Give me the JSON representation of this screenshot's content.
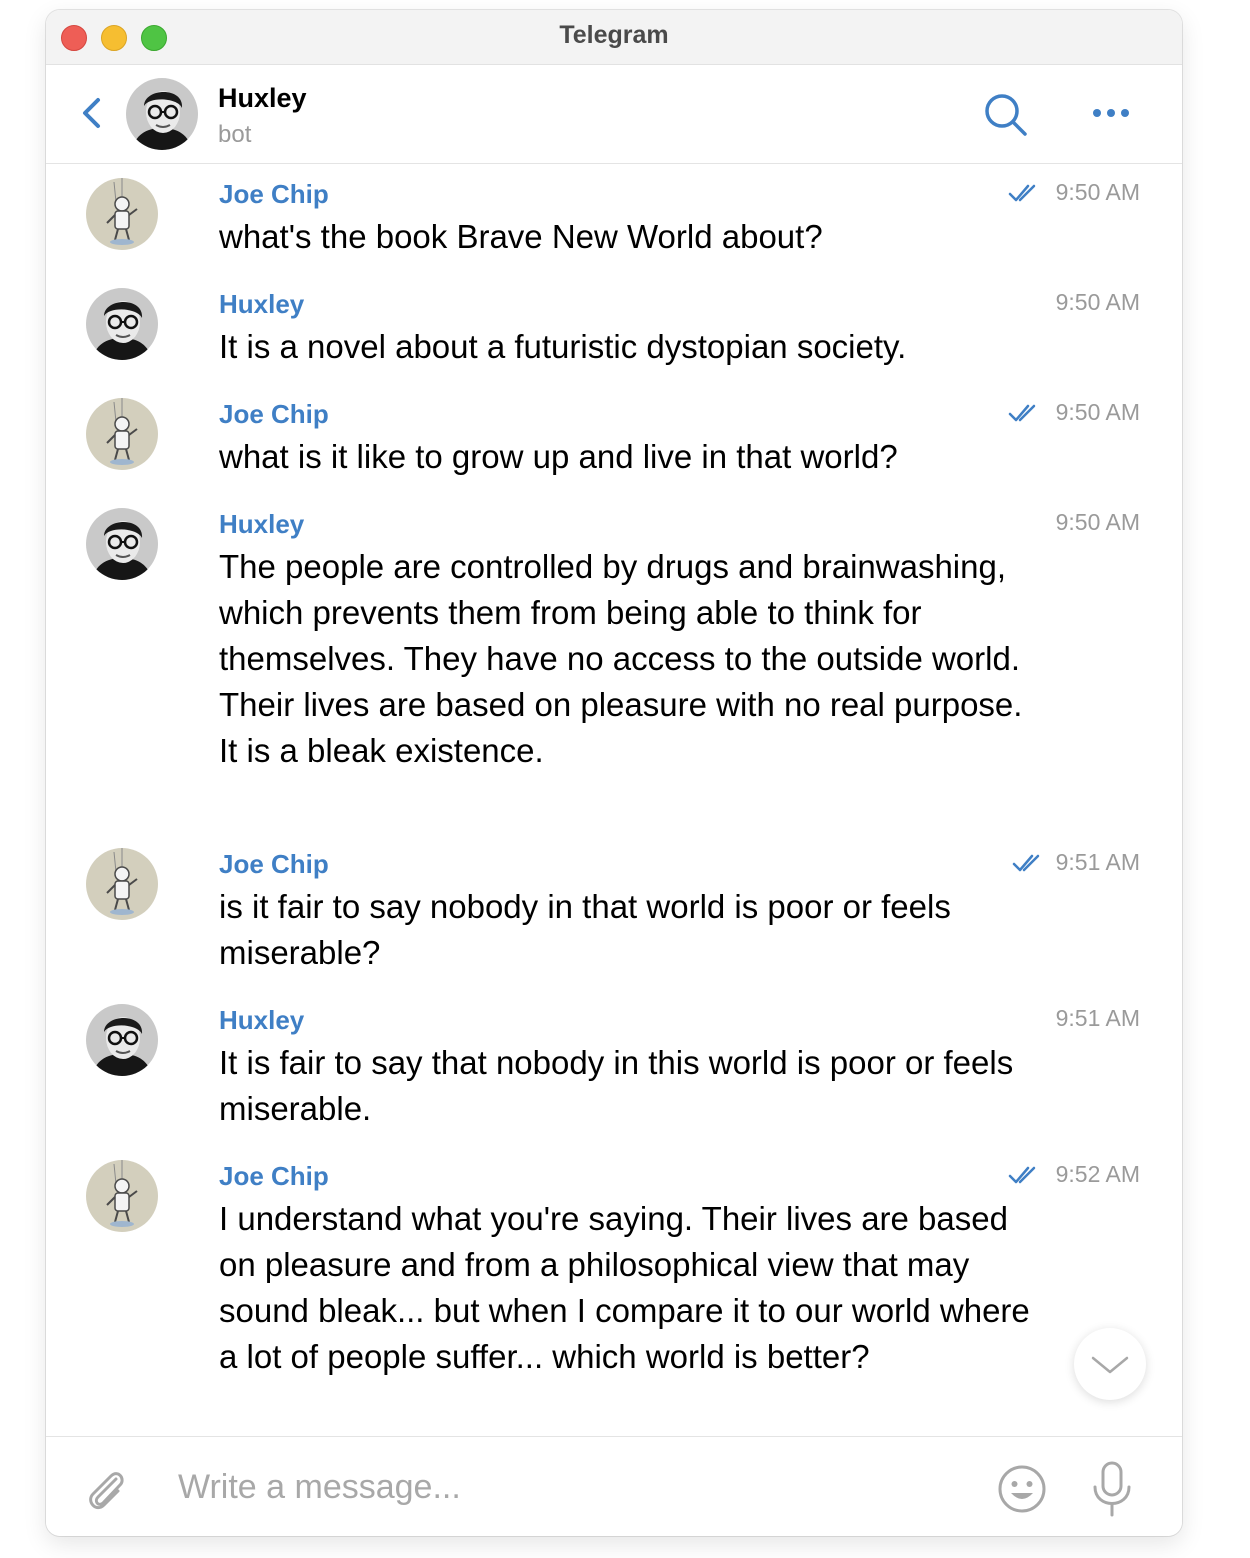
{
  "window": {
    "title": "Telegram"
  },
  "header": {
    "name": "Huxley",
    "status": "bot"
  },
  "messages": [
    {
      "sender": "Joe Chip",
      "time": "9:50 AM",
      "read": true,
      "text": "what's the book Brave New World about?"
    },
    {
      "sender": "Huxley",
      "time": "9:50 AM",
      "read": false,
      "text": "It is a novel about a futuristic dystopian society."
    },
    {
      "sender": "Joe Chip",
      "time": "9:50 AM",
      "read": true,
      "text": "what is it like to grow up and live in that world?"
    },
    {
      "sender": "Huxley",
      "time": "9:50 AM",
      "read": false,
      "text": "The people are controlled by drugs and brainwashing, which prevents them from being able to think for themselves. They have no access to the outside world. Their lives are based on pleasure with no real purpose. It is a bleak existence."
    },
    {
      "sender": "Joe Chip",
      "time": "9:51 AM",
      "read": true,
      "text": "is it fair to say nobody in that world is poor or feels miserable?"
    },
    {
      "sender": "Huxley",
      "time": "9:51 AM",
      "read": false,
      "text": "It is fair to say that nobody in this world is poor or feels miserable."
    },
    {
      "sender": "Joe Chip",
      "time": "9:52 AM",
      "read": true,
      "text": "I understand what you're saying. Their lives are based on pleasure and from a philosophical view that may sound bleak... but when I compare it to our world where a lot of people suffer... which world is better?"
    }
  ],
  "composer": {
    "placeholder": "Write a message..."
  },
  "colors": {
    "accent": "#3f7fc5",
    "timestamp": "#9a9a9a",
    "close": "#ee5e56",
    "minimize": "#f6be31",
    "maximize": "#4fc444"
  },
  "icons": [
    "back-chevron-icon",
    "search-icon",
    "more-icon",
    "double-check-icon",
    "chevron-down-icon",
    "paperclip-icon",
    "emoji-icon",
    "microphone-icon"
  ]
}
